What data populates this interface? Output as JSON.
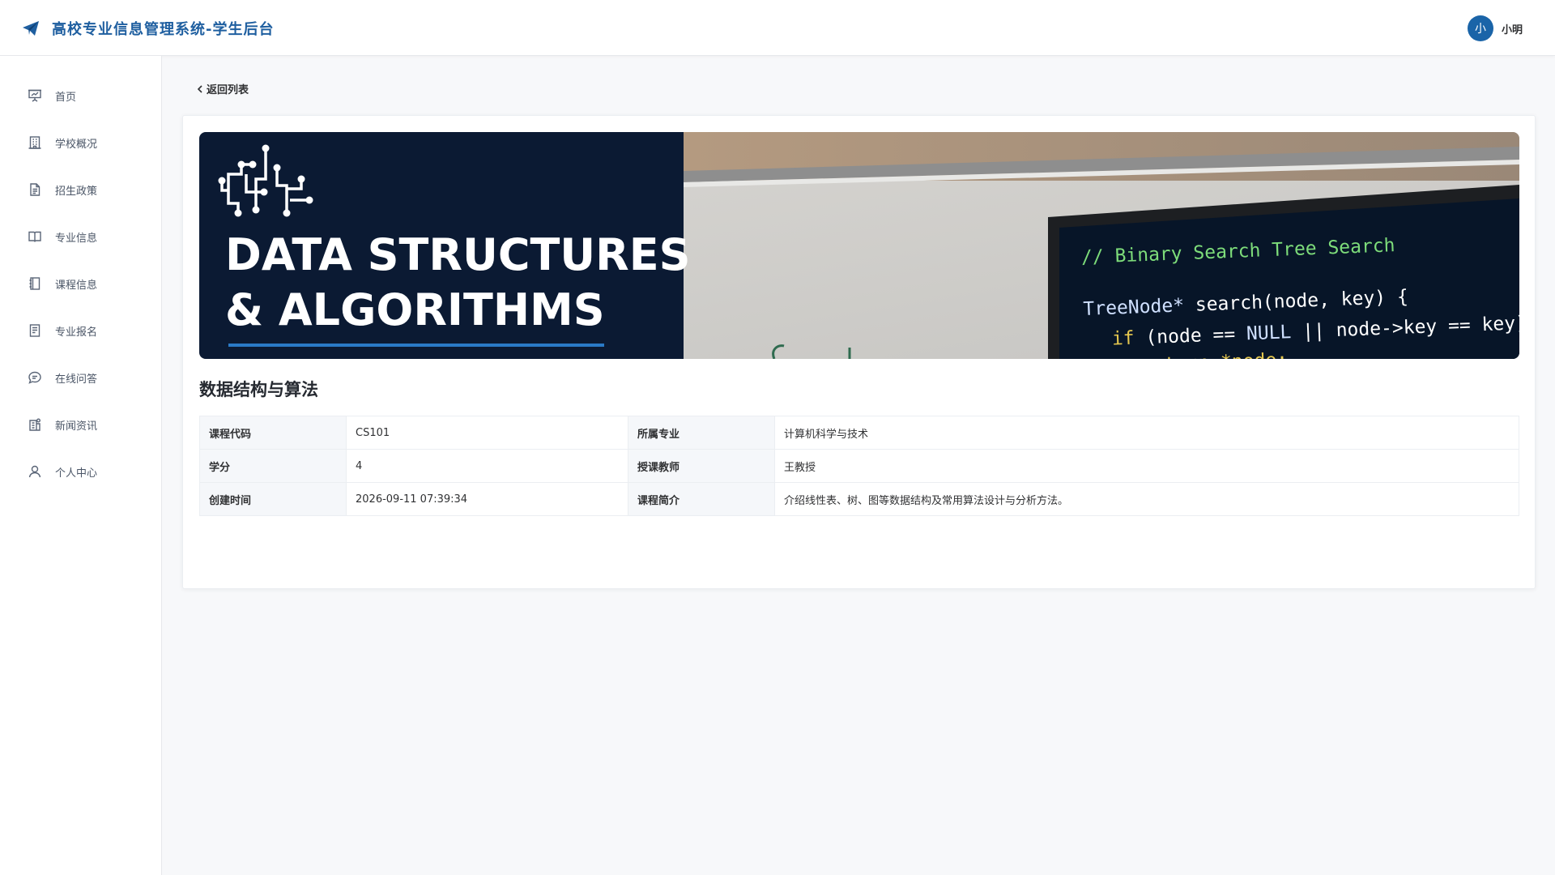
{
  "header": {
    "title": "高校专业信息管理系统-学生后台",
    "brand_icon": "paper-plane-icon",
    "user": {
      "avatar_text": "小",
      "name": "小明"
    }
  },
  "sidebar": {
    "items": [
      {
        "label": "首页",
        "icon": "presentation-icon"
      },
      {
        "label": "学校概况",
        "icon": "building-icon"
      },
      {
        "label": "招生政策",
        "icon": "document-icon"
      },
      {
        "label": "专业信息",
        "icon": "book-icon"
      },
      {
        "label": "课程信息",
        "icon": "notebook-icon"
      },
      {
        "label": "专业报名",
        "icon": "form-icon"
      },
      {
        "label": "在线问答",
        "icon": "chat-icon"
      },
      {
        "label": "新闻资讯",
        "icon": "news-icon"
      },
      {
        "label": "个人中心",
        "icon": "user-icon"
      }
    ]
  },
  "main": {
    "back_label": "返回列表",
    "banner": {
      "line1": "DATA STRUCTURES",
      "line2": "& ALGORITHMS",
      "code_comment": "// Binary Search Tree Search",
      "code_line1_type": "TreeNode*",
      "code_line1_rest": " search(node, key) {",
      "code_line2_kw": "if",
      "code_line2_a": " (node == ",
      "code_line2_null": "NULL",
      "code_line2_b": " || node->key == key)",
      "code_line3": "return *node;"
    },
    "course_title": "数据结构与算法",
    "details": {
      "course_code_label": "课程代码",
      "course_code": "CS101",
      "major_label": "所属专业",
      "major": "计算机科学与技术",
      "credit_label": "学分",
      "credit": "4",
      "teacher_label": "授课教师",
      "teacher": "王教授",
      "created_label": "创建时间",
      "created": "2026-09-11 07:39:34",
      "intro_label": "课程简介",
      "intro": "介绍线性表、树、图等数据结构及常用算法设计与分析方法。"
    }
  },
  "colors": {
    "brand": "#1f5fa0",
    "avatar": "#1a64a8",
    "banner_dark": "#0b1a33",
    "code_green": "#7ddc7a",
    "code_yellow": "#e6c84f"
  }
}
